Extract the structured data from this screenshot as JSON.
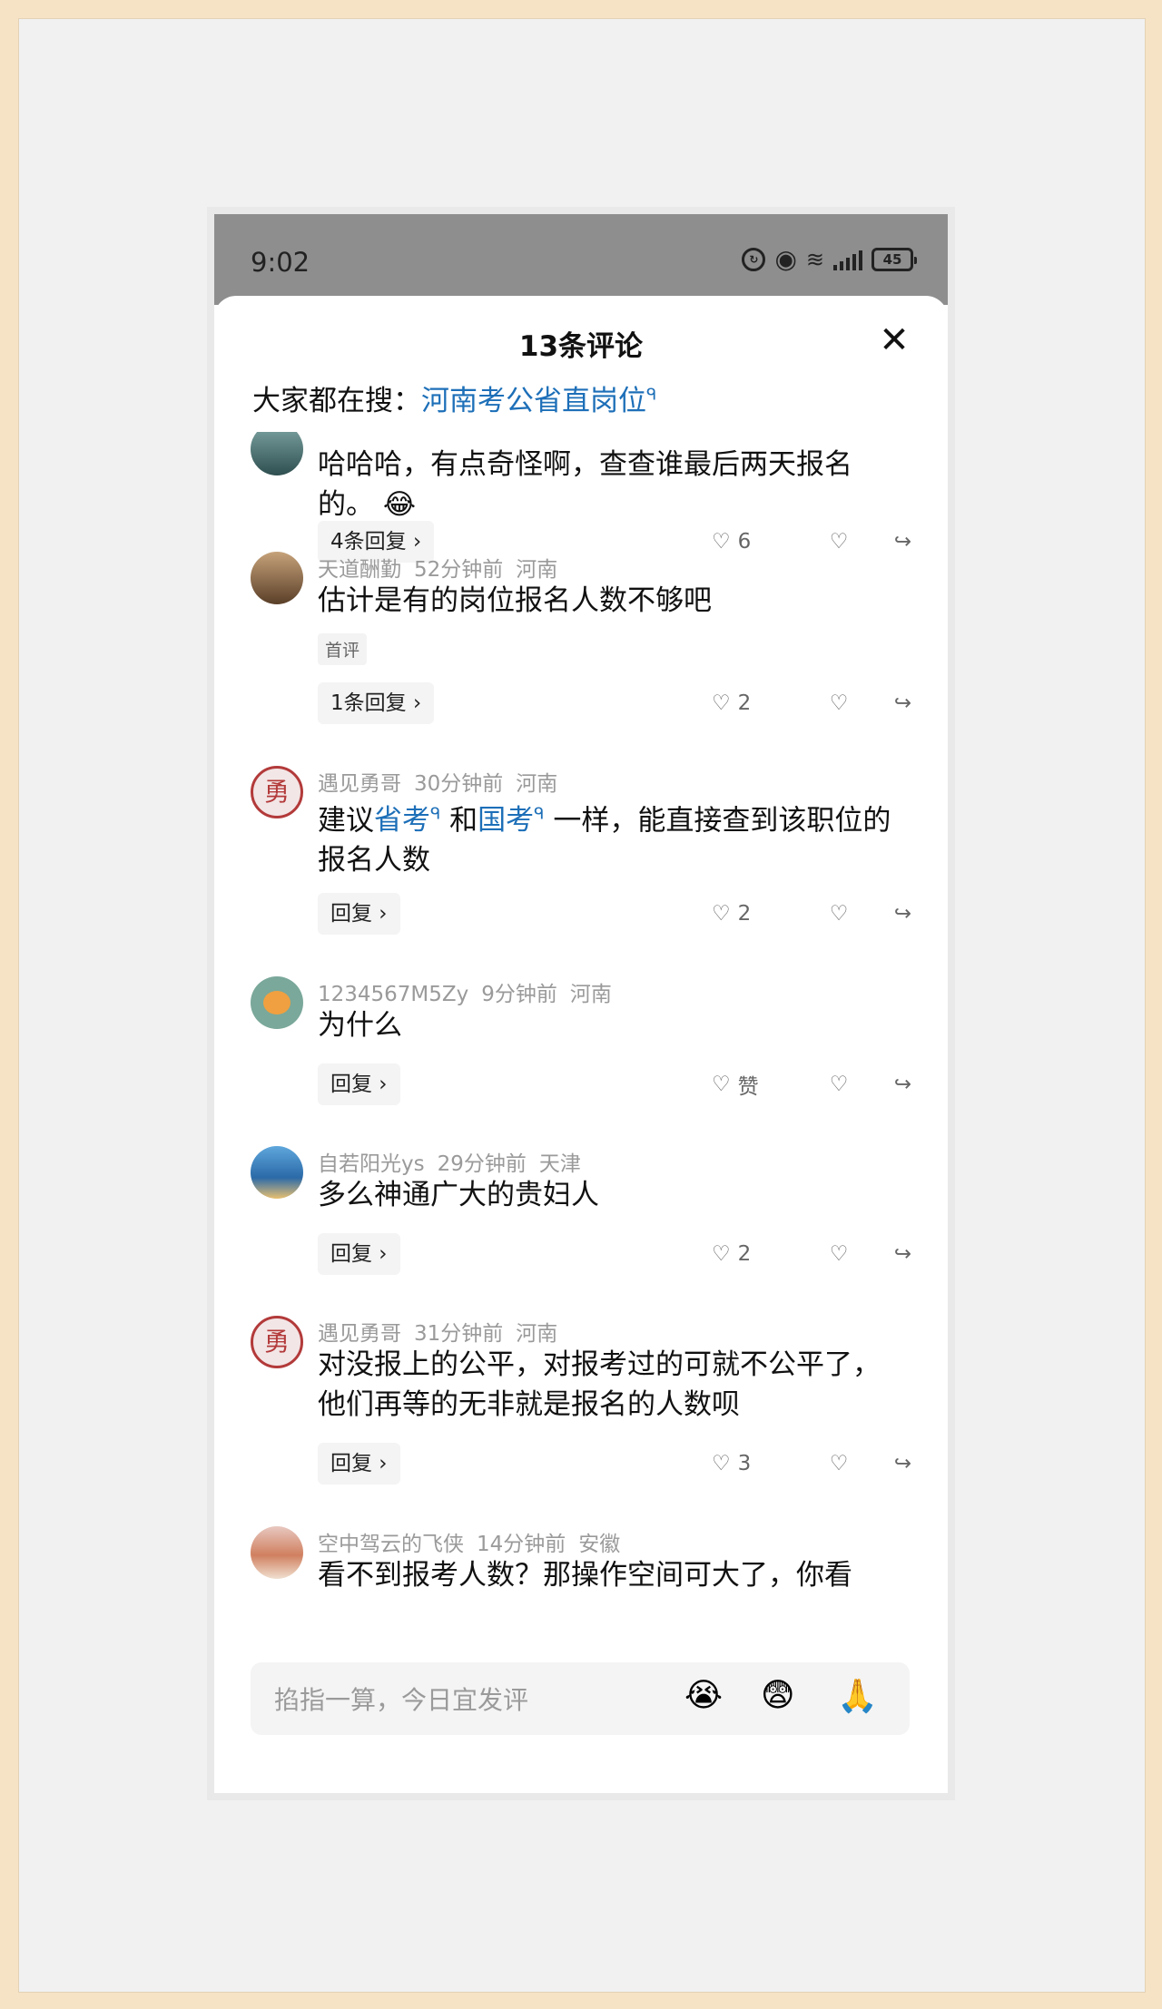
{
  "status": {
    "time": "9:02",
    "battery": "45"
  },
  "sheet": {
    "title": "13条评论",
    "search_label": "大家都在搜：",
    "search_link": "河南考公省直岗位"
  },
  "comments": [
    {
      "user": "",
      "time": "",
      "loc": "",
      "body": "哈哈哈，有点奇怪啊，查查谁最后两天报名的。",
      "replies": "4条回复",
      "likes": "6"
    },
    {
      "user": "天道酬勤",
      "time": "52分钟前",
      "loc": "河南",
      "body": "估计是有的岗位报名人数不够吧",
      "tag": "首评",
      "replies": "1条回复",
      "likes": "2"
    },
    {
      "user": "遇见勇哥",
      "time": "30分钟前",
      "loc": "河南",
      "body_pre": "建议",
      "link1": "省考",
      "body_mid": "和",
      "link2": "国考",
      "body_post": "一样，能直接查到该职位的报名人数",
      "replies": "回复",
      "likes": "2"
    },
    {
      "user": "1234567M5Zy",
      "time": "9分钟前",
      "loc": "河南",
      "body": "为什么",
      "replies": "回复",
      "likes": "赞"
    },
    {
      "user": "自若阳光ys",
      "time": "29分钟前",
      "loc": "天津",
      "body": "多么神通广大的贵妇人",
      "replies": "回复",
      "likes": "2"
    },
    {
      "user": "遇见勇哥",
      "time": "31分钟前",
      "loc": "河南",
      "body": "对没报上的公平，对报考过的可就不公平了，他们再等的无非就是报名的人数呗",
      "replies": "回复",
      "likes": "3"
    },
    {
      "user": "空中驾云的飞侠",
      "time": "14分钟前",
      "loc": "安徽",
      "body": "看不到报考人数？那操作空间可大了，你看"
    }
  ],
  "input": {
    "placeholder": "掐指一算，今日宜发评"
  },
  "emojis": [
    "😭",
    "😨",
    "🙏"
  ],
  "avatar_colors": [
    "#3f6b6a",
    "#8a6a4a",
    "#b33a3a",
    "#7aa89a",
    "#4b8bc4",
    "#b33a3a",
    "#d9a08a"
  ]
}
